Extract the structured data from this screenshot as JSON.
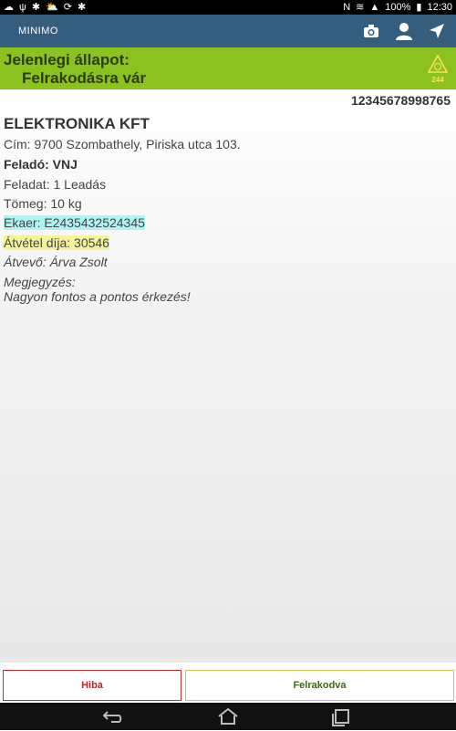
{
  "status_bar": {
    "time": "12:30",
    "battery": "100%",
    "left_icons": [
      "notification-icon",
      "usb-icon",
      "debug-icon",
      "cloud-icon",
      "sync-icon",
      "debug-icon"
    ],
    "right_icons": [
      "nfc-icon",
      "wifi-icon",
      "signal-icon",
      "battery-icon"
    ]
  },
  "app_bar": {
    "title": "MINIMO",
    "actions": [
      "camera-icon",
      "user-icon",
      "navigation-icon"
    ]
  },
  "status": {
    "label": "Jelenlegi állapot:",
    "value": "Felrakodásra vár",
    "warning_count": "244"
  },
  "details": {
    "tracking_number": "12345678998765",
    "company": "ELEKTRONIKA KFT",
    "address": "Cím: 9700 Szombathely, Piriska utca 103.",
    "sender": "Feladó: VNJ",
    "task": "Feladat: 1 Leadás",
    "weight": "Tömeg: 10 kg",
    "ekaer": "Ekaer: E2435432524345",
    "fee": "Átvétel díja: 30546",
    "recipient": "Átvevő: Árva Zsolt",
    "note_label": "Megjegyzés:",
    "note_text": "Nagyon fontos a pontos érkezés!"
  },
  "actions": {
    "error_label": "Hiba",
    "loaded_label": "Felrakodva"
  },
  "colors": {
    "app_bar": "#355d7d",
    "status_bg": "#8cc21f",
    "error": "#c62222",
    "loaded": "#3f6b0e"
  }
}
